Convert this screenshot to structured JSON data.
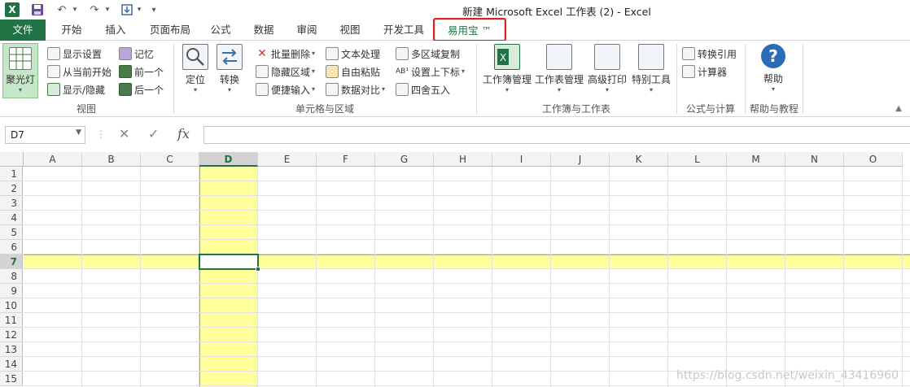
{
  "window": {
    "title": "新建 Microsoft Excel 工作表 (2) - Excel"
  },
  "qat": {
    "logo": "X",
    "save_icon": "save-icon",
    "undo": "↶",
    "redo": "↷",
    "customize": "▾"
  },
  "tabs": [
    "文件",
    "开始",
    "插入",
    "页面布局",
    "公式",
    "数据",
    "审阅",
    "视图",
    "开发工具",
    "易用宝 ™"
  ],
  "ribbon": {
    "view_group": {
      "label": "视图",
      "spotlight": "聚光灯",
      "display_settings": "显示设置",
      "from_current": "从当前开始",
      "show_hide": "显示/隐藏",
      "memory": "记忆",
      "prev": "前一个",
      "next": "后一个"
    },
    "cell_group": {
      "label": "单元格与区域",
      "locate": "定位",
      "convert": "转换",
      "batch_delete": "批量删除",
      "hide_range": "隐藏区域",
      "quick_input": "便捷输入",
      "text_process": "文本处理",
      "free_paste": "自由粘贴",
      "data_compare": "数据对比",
      "multi_copy": "多区域复制",
      "sup_sub": "设置上下标",
      "round": "四舍五入"
    },
    "workbook_group": {
      "label": "工作簿与工作表",
      "workbook_mgmt": "工作簿管理",
      "sheet_mgmt": "工作表管理",
      "adv_print": "高级打印",
      "special_tools": "特别工具"
    },
    "formula_group": {
      "label": "公式与计算",
      "convert_ref": "转换引用",
      "calculator": "计算器"
    },
    "help_group": {
      "label": "帮助与教程",
      "help": "帮助"
    }
  },
  "formula_bar": {
    "name_box": "D7",
    "cancel": "✕",
    "enter": "✓",
    "fx": "fx",
    "content": ""
  },
  "sheet": {
    "columns": [
      "A",
      "B",
      "C",
      "D",
      "E",
      "F",
      "G",
      "H",
      "I",
      "J",
      "K",
      "L",
      "M",
      "N",
      "O"
    ],
    "rows": [
      "1",
      "2",
      "3",
      "4",
      "5",
      "6",
      "7",
      "8",
      "9",
      "10",
      "11",
      "12",
      "13",
      "14",
      "15"
    ],
    "active_cell": "D7",
    "highlight_color": "#ffff99"
  },
  "colors": {
    "accent": "#217346",
    "highlight_box": "#e02020"
  },
  "watermark": "https://blog.csdn.net/weixin_43416960"
}
